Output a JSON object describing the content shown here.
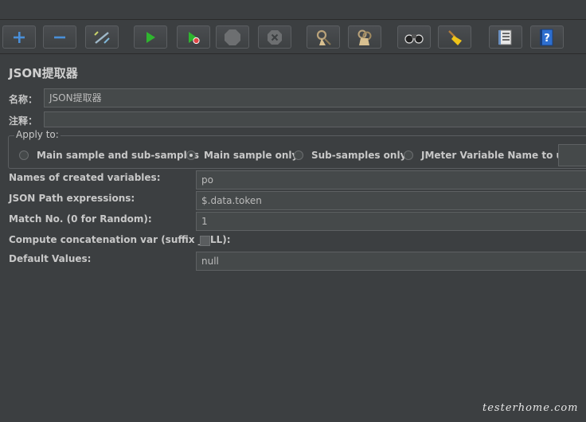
{
  "toolbar": {
    "buttons": [
      {
        "name": "add",
        "icon": "plus-icon"
      },
      {
        "name": "remove",
        "icon": "minus-icon"
      },
      {
        "name": "toggle",
        "icon": "wand-icon"
      },
      {
        "name": "start",
        "icon": "play-icon"
      },
      {
        "name": "start-no-pause",
        "icon": "play-nopause-icon"
      },
      {
        "name": "stop",
        "icon": "stop-icon"
      },
      {
        "name": "shutdown",
        "icon": "shutdown-icon"
      },
      {
        "name": "clear",
        "icon": "clear-icon"
      },
      {
        "name": "clear-all",
        "icon": "clear-all-icon"
      },
      {
        "name": "search",
        "icon": "binoculars-icon"
      },
      {
        "name": "reset-search",
        "icon": "broom-icon"
      },
      {
        "name": "function-helper",
        "icon": "list-icon"
      },
      {
        "name": "help",
        "icon": "help-book-icon"
      }
    ]
  },
  "panel": {
    "title": "JSON提取器",
    "name_label": "名称：",
    "name_value": "JSON提取器",
    "comment_label": "注释：",
    "comment_value": ""
  },
  "apply_to": {
    "legend": "Apply to:",
    "options": [
      {
        "label": "Main sample and sub-samples",
        "selected": false
      },
      {
        "label": "Main sample only",
        "selected": true
      },
      {
        "label": "Sub-samples only",
        "selected": false
      },
      {
        "label": "JMeter Variable Name to use",
        "selected": false
      }
    ],
    "variable_name_value": ""
  },
  "fields": {
    "names_label": "Names of created variables:",
    "names_value": "po",
    "paths_label": "JSON Path expressions:",
    "paths_value": "$.data.token",
    "match_label": "Match No. (0 for Random):",
    "match_value": "1",
    "concat_label": "Compute concatenation var (suffix _ALL):",
    "concat_checked": false,
    "default_label": "Default Values:",
    "default_value": "null"
  },
  "watermark": "testerhome.com",
  "colors": {
    "background": "#3c3f41",
    "field_background": "#45494a",
    "text": "#bbbbbb",
    "play_green": "#2fb52f",
    "accent_blue": "#4a8fd8"
  }
}
